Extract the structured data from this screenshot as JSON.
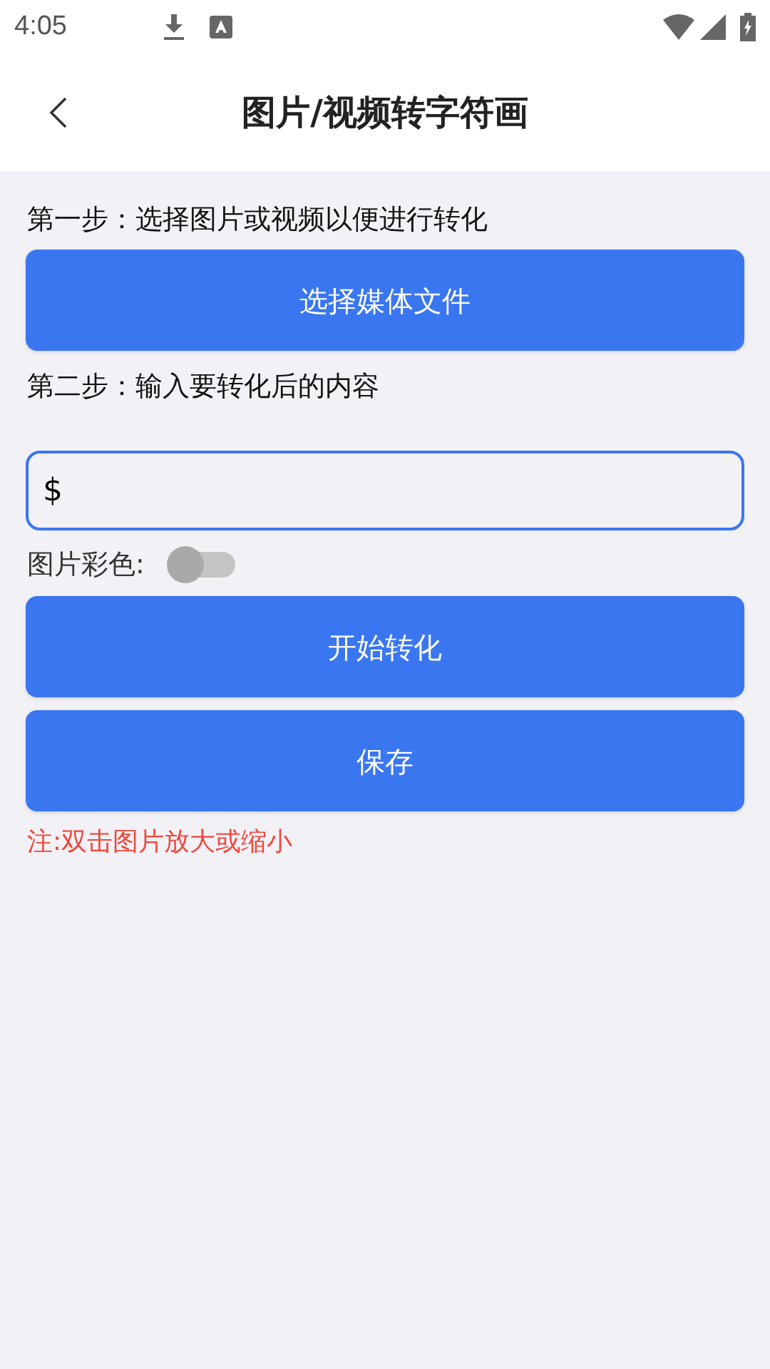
{
  "status_bar": {
    "time": "4:05"
  },
  "header": {
    "title": "图片/视频转字符画"
  },
  "step1": {
    "label": "第一步：选择图片或视频以便进行转化",
    "button": "选择媒体文件"
  },
  "step2": {
    "label": "第二步：输入要转化后的内容",
    "input_value": "$"
  },
  "color_toggle": {
    "label": "图片彩色:",
    "on": false
  },
  "buttons": [
    "开始转化",
    "保存"
  ],
  "note": "注:双击图片放大或缩小"
}
